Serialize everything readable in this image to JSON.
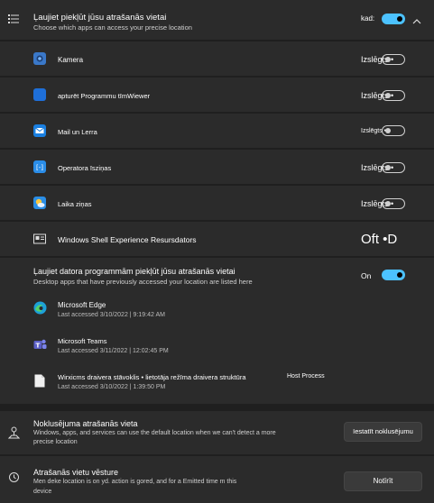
{
  "header": {
    "title": "Ļaujiet piekļūt jūsu atrašanās vietai",
    "subtitle": "Choose which apps can access your precise location",
    "toggle_label": "kad:"
  },
  "apps": [
    {
      "name": "Kamera",
      "state": "Izslēgts •",
      "icon": "camera-icon"
    },
    {
      "name": "apturēt Programmu tīmWiewer",
      "state": "Izslēgts •",
      "icon": "webviewer-icon"
    },
    {
      "name": "Mail un Lerra",
      "state": "Izslēgts •",
      "icon": "mail-icon"
    },
    {
      "name": "Operatora īsziņas",
      "state": "Izslēgts •",
      "icon": "messaging-icon"
    },
    {
      "name": "Laika ziņas",
      "state": "Izslēgts •",
      "icon": "weather-icon"
    },
    {
      "name": "Windows Shell Experience Resursdators",
      "state": "Oft •D",
      "icon": "shell-icon"
    }
  ],
  "desktop": {
    "title": "Ļaujiet datora programmām piekļūt jūsu atrašanās vietai",
    "subtitle": "Desktop apps that have previously accessed your location are listed here",
    "toggle_label": "On",
    "apps": [
      {
        "name": "Microsoft Edge",
        "accessed": "Last accessed 3/10/2022  |  9:19:42 AM",
        "icon": "edge-icon"
      },
      {
        "name": "Microsoft Teams",
        "accessed": "Last accessed 3/11/2022  |  12:02:45 PM",
        "icon": "teams-icon"
      },
      {
        "name": "Wirxicms draivera stāvoklis • lietotāja režīma draivera struktūra",
        "suffix": "Host Process",
        "accessed": "Last accessed 3/10/2022  |  1:39:50 PM",
        "icon": "file-icon"
      }
    ]
  },
  "default_location": {
    "title": "Noklusējuma atrašanās vieta",
    "description_line1": "Windows, apps, and services can use the default location when we can't detect a more",
    "description_line2": "precise location",
    "button": "Iestatīt noklusējumu"
  },
  "history": {
    "title": "Atrašanās vietu vēsture",
    "description_line1": "Men deke location is on yd. action is gored, and for a Emitted time m this",
    "description_line2": "device",
    "button": "Notīrīt"
  },
  "colors": {
    "accent": "#4cc2ff",
    "card": "#2b2b2b",
    "background": "#1f1f1f"
  }
}
